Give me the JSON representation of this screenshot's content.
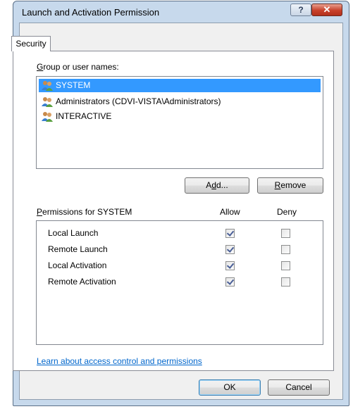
{
  "window": {
    "title": "Launch and Activation Permission",
    "help_glyph": "?",
    "close_glyph": "✕"
  },
  "tabs": [
    {
      "label": "Security"
    }
  ],
  "group_label": "Group or user names:",
  "users": [
    {
      "name": "SYSTEM",
      "selected": true
    },
    {
      "name": "Administrators (CDVI-VISTA\\Administrators)",
      "selected": false
    },
    {
      "name": "INTERACTIVE",
      "selected": false
    }
  ],
  "buttons": {
    "add": "Add...",
    "remove": "Remove",
    "ok": "OK",
    "cancel": "Cancel"
  },
  "permissions": {
    "title": "Permissions for SYSTEM",
    "allow_header": "Allow",
    "deny_header": "Deny",
    "rows": [
      {
        "name": "Local Launch",
        "allow": true,
        "deny": false
      },
      {
        "name": "Remote Launch",
        "allow": true,
        "deny": false
      },
      {
        "name": "Local Activation",
        "allow": true,
        "deny": false
      },
      {
        "name": "Remote Activation",
        "allow": true,
        "deny": false
      }
    ]
  },
  "learn_link": "Learn about access control and permissions",
  "icons": {
    "user": "users-group-icon",
    "help": "help-icon",
    "close": "close-icon"
  }
}
